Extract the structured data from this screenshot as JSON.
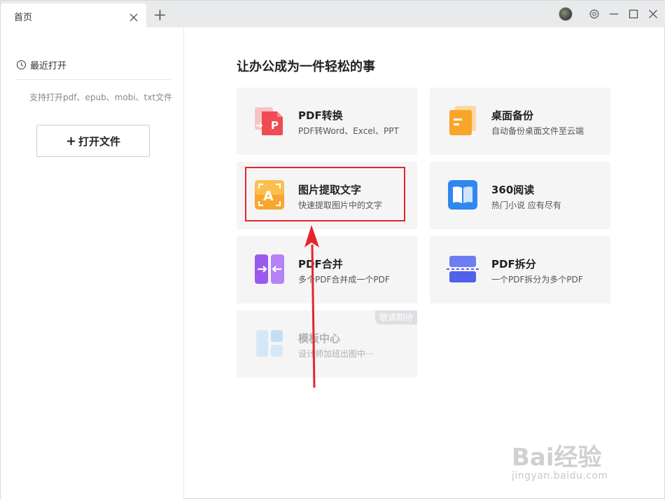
{
  "titlebar": {
    "tab_label": "首页"
  },
  "sidebar": {
    "recent_label": "最近打开",
    "support_text": "支持打开pdf、epub、mobi、txt文件",
    "open_button_label": "打开文件"
  },
  "main": {
    "title": "让办公成为一件轻松的事",
    "cards": [
      {
        "title": "PDF转换",
        "desc": "PDF转Word、Excel、PPT",
        "icon": "pdf-convert-icon"
      },
      {
        "title": "桌面备份",
        "desc": "自动备份桌面文件至云端",
        "icon": "desktop-backup-icon"
      },
      {
        "title": "图片提取文字",
        "desc": "快速提取图片中的文字",
        "icon": "image-text-extract-icon"
      },
      {
        "title": "360阅读",
        "desc": "热门小说 应有尽有",
        "icon": "book-reading-icon"
      },
      {
        "title": "PDF合并",
        "desc": "多个PDF合并成一个PDF",
        "icon": "pdf-merge-icon"
      },
      {
        "title": "PDF拆分",
        "desc": "一个PDF拆分为多个PDF",
        "icon": "pdf-split-icon"
      },
      {
        "title": "模板中心",
        "desc": "设计师加班出图中···",
        "icon": "template-center-icon",
        "badge": "敬请期待"
      }
    ]
  },
  "colors": {
    "highlight": "#e3262b",
    "arrow": "#e3262b"
  },
  "watermark": {
    "brand": "Bai经验",
    "url": "jingyan.baidu.com"
  }
}
